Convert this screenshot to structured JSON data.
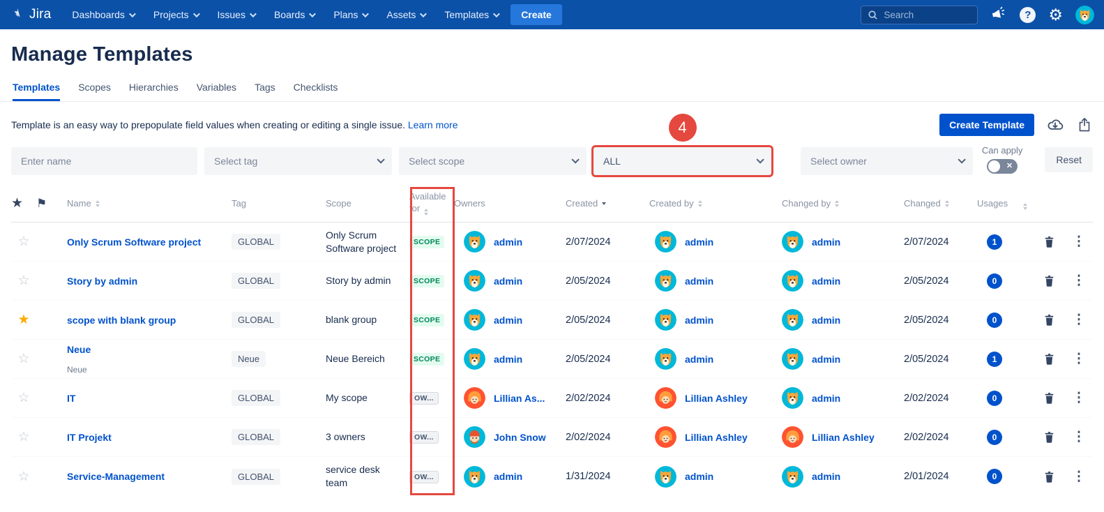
{
  "nav": {
    "brand": "Jira",
    "items": [
      "Dashboards",
      "Projects",
      "Issues",
      "Boards",
      "Plans",
      "Assets",
      "Templates"
    ],
    "create_label": "Create",
    "search_placeholder": "Search"
  },
  "page": {
    "title": "Manage Templates",
    "tabs": [
      {
        "label": "Templates",
        "active": true
      },
      {
        "label": "Scopes",
        "active": false
      },
      {
        "label": "Hierarchies",
        "active": false
      },
      {
        "label": "Variables",
        "active": false
      },
      {
        "label": "Tags",
        "active": false
      },
      {
        "label": "Checklists",
        "active": false
      }
    ],
    "description": "Template is an easy way to prepopulate field values when creating or editing a single issue.",
    "learn_more": "Learn more"
  },
  "toolbar": {
    "create_template": "Create Template",
    "can_apply_label": "Can apply",
    "reset_label": "Reset"
  },
  "filters": {
    "name_placeholder": "Enter name",
    "tag_placeholder": "Select tag",
    "scope_placeholder": "Select scope",
    "available_for_value": "ALL",
    "owner_placeholder": "Select owner"
  },
  "annotation": {
    "badge": "4"
  },
  "colors": {
    "navbar": "#0B51A8",
    "link": "#0052CC",
    "annotation_red": "#E5483F",
    "scope_badge_bg": "#E3FCEF",
    "scope_badge_text": "#00875A",
    "usage_badge": "#0052CC",
    "avatar_teal": "#00B8D9",
    "avatar_orange": "#FF5230",
    "star_active": "#FFAB00"
  },
  "table": {
    "headers": [
      {
        "key": "star",
        "label": "",
        "icon": "star-icon"
      },
      {
        "key": "flag",
        "label": "",
        "icon": "flag-icon"
      },
      {
        "key": "name",
        "label": "Name",
        "sort": "both"
      },
      {
        "key": "tag",
        "label": "Tag",
        "sort": null
      },
      {
        "key": "scope",
        "label": "Scope",
        "sort": null
      },
      {
        "key": "available_for",
        "label": "Available for",
        "sort": "both"
      },
      {
        "key": "owners",
        "label": "Owners",
        "sort": null
      },
      {
        "key": "created",
        "label": "Created",
        "sort": "desc"
      },
      {
        "key": "created_by",
        "label": "Created by",
        "sort": "both"
      },
      {
        "key": "changed_by",
        "label": "Changed by",
        "sort": "both"
      },
      {
        "key": "changed",
        "label": "Changed",
        "sort": "both"
      },
      {
        "key": "usages",
        "label": "Usages",
        "sort": "both"
      },
      {
        "key": "delete",
        "label": ""
      },
      {
        "key": "menu",
        "label": ""
      }
    ],
    "rows": [
      {
        "starred": false,
        "name": "Only Scrum Software project",
        "subtitle": null,
        "tag": "GLOBAL",
        "scope": "Only Scrum Software project",
        "available_for": {
          "label": "SCOPE",
          "type": "scope"
        },
        "owner": {
          "name": "admin",
          "avatar": "admin"
        },
        "created": "2/07/2024",
        "created_by": {
          "name": "admin",
          "avatar": "admin"
        },
        "changed_by": {
          "name": "admin",
          "avatar": "admin"
        },
        "changed": "2/07/2024",
        "usages": "1"
      },
      {
        "starred": false,
        "name": "Story by admin",
        "subtitle": null,
        "tag": "GLOBAL",
        "scope": "Story by admin",
        "available_for": {
          "label": "SCOPE",
          "type": "scope"
        },
        "owner": {
          "name": "admin",
          "avatar": "admin"
        },
        "created": "2/05/2024",
        "created_by": {
          "name": "admin",
          "avatar": "admin"
        },
        "changed_by": {
          "name": "admin",
          "avatar": "admin"
        },
        "changed": "2/05/2024",
        "usages": "0"
      },
      {
        "starred": true,
        "name": "scope with blank group",
        "subtitle": null,
        "tag": "GLOBAL",
        "scope": "blank group",
        "available_for": {
          "label": "SCOPE",
          "type": "scope"
        },
        "owner": {
          "name": "admin",
          "avatar": "admin"
        },
        "created": "2/05/2024",
        "created_by": {
          "name": "admin",
          "avatar": "admin"
        },
        "changed_by": {
          "name": "admin",
          "avatar": "admin"
        },
        "changed": "2/05/2024",
        "usages": "0"
      },
      {
        "starred": false,
        "name": "Neue",
        "subtitle": "Neue",
        "tag": "Neue",
        "scope": "Neue Bereich",
        "available_for": {
          "label": "SCOPE",
          "type": "scope"
        },
        "owner": {
          "name": "admin",
          "avatar": "admin"
        },
        "created": "2/05/2024",
        "created_by": {
          "name": "admin",
          "avatar": "admin"
        },
        "changed_by": {
          "name": "admin",
          "avatar": "admin"
        },
        "changed": "2/05/2024",
        "usages": "1"
      },
      {
        "starred": false,
        "name": "IT",
        "subtitle": null,
        "tag": "GLOBAL",
        "scope": "My scope",
        "available_for": {
          "label": "OW...",
          "type": "owner"
        },
        "owner": {
          "name": "Lillian As...",
          "avatar": "lillian"
        },
        "created": "2/02/2024",
        "created_by": {
          "name": "Lillian Ashley",
          "avatar": "lillian"
        },
        "changed_by": {
          "name": "admin",
          "avatar": "admin"
        },
        "changed": "2/02/2024",
        "usages": "0"
      },
      {
        "starred": false,
        "name": "IT Projekt",
        "subtitle": null,
        "tag": "GLOBAL",
        "scope": "3 owners",
        "available_for": {
          "label": "OW...",
          "type": "owner"
        },
        "owner": {
          "name": "John Snow",
          "avatar": "john"
        },
        "created": "2/02/2024",
        "created_by": {
          "name": "Lillian Ashley",
          "avatar": "lillian"
        },
        "changed_by": {
          "name": "Lillian Ashley",
          "avatar": "lillian"
        },
        "changed": "2/02/2024",
        "usages": "0"
      },
      {
        "starred": false,
        "name": "Service-Management",
        "subtitle": null,
        "tag": "GLOBAL",
        "scope": "service desk team",
        "available_for": {
          "label": "OW...",
          "type": "owner"
        },
        "owner": {
          "name": "admin",
          "avatar": "admin"
        },
        "created": "1/31/2024",
        "created_by": {
          "name": "admin",
          "avatar": "admin"
        },
        "changed_by": {
          "name": "admin",
          "avatar": "admin"
        },
        "changed": "2/01/2024",
        "usages": "0"
      }
    ]
  }
}
